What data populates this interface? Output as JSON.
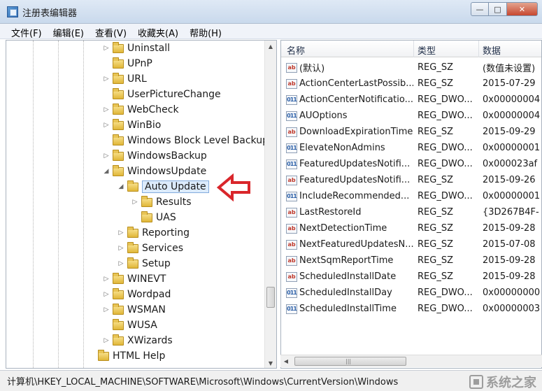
{
  "window": {
    "title": "注册表编辑器",
    "minimize": "—",
    "maximize": "□",
    "close": "✕"
  },
  "menu": [
    "文件(F)",
    "编辑(E)",
    "查看(V)",
    "收藏夹(A)",
    "帮助(H)"
  ],
  "tree": [
    {
      "label": "Uninstall",
      "expander": "▷",
      "level": 0
    },
    {
      "label": "UPnP",
      "expander": "",
      "level": 0
    },
    {
      "label": "URL",
      "expander": "▷",
      "level": 0
    },
    {
      "label": "UserPictureChange",
      "expander": "",
      "level": 0
    },
    {
      "label": "WebCheck",
      "expander": "▷",
      "level": 0
    },
    {
      "label": "WinBio",
      "expander": "▷",
      "level": 0
    },
    {
      "label": "Windows Block Level Backup",
      "expander": "",
      "level": 0
    },
    {
      "label": "WindowsBackup",
      "expander": "▷",
      "level": 0
    },
    {
      "label": "WindowsUpdate",
      "expander": "◢",
      "level": 0
    },
    {
      "label": "Auto Update",
      "expander": "◢",
      "level": 1,
      "selected": true
    },
    {
      "label": "Results",
      "expander": "▷",
      "level": 2
    },
    {
      "label": "UAS",
      "expander": "",
      "level": 2
    },
    {
      "label": "Reporting",
      "expander": "▷",
      "level": 1
    },
    {
      "label": "Services",
      "expander": "▷",
      "level": 1
    },
    {
      "label": "Setup",
      "expander": "▷",
      "level": 1
    },
    {
      "label": "WINEVT",
      "expander": "▷",
      "level": 0
    },
    {
      "label": "Wordpad",
      "expander": "▷",
      "level": 0
    },
    {
      "label": "WSMAN",
      "expander": "▷",
      "level": 0
    },
    {
      "label": "WUSA",
      "expander": "",
      "level": 0
    },
    {
      "label": "XWizards",
      "expander": "▷",
      "level": 0
    },
    {
      "label": "HTML Help",
      "expander": "",
      "level": -1
    }
  ],
  "columns": {
    "name": "名称",
    "type": "类型",
    "data": "数据"
  },
  "values": [
    {
      "icon": "ab",
      "name": "(默认)",
      "type": "REG_SZ",
      "data": "(数值未设置)"
    },
    {
      "icon": "ab",
      "name": "ActionCenterLastPossib...",
      "type": "REG_SZ",
      "data": "2015-07-29"
    },
    {
      "icon": "011",
      "name": "ActionCenterNotificatio...",
      "type": "REG_DWO...",
      "data": "0x00000004"
    },
    {
      "icon": "011",
      "name": "AUOptions",
      "type": "REG_DWO...",
      "data": "0x00000004"
    },
    {
      "icon": "ab",
      "name": "DownloadExpirationTime",
      "type": "REG_SZ",
      "data": "2015-09-29"
    },
    {
      "icon": "011",
      "name": "ElevateNonAdmins",
      "type": "REG_DWO...",
      "data": "0x00000001"
    },
    {
      "icon": "011",
      "name": "FeaturedUpdatesNotifi...",
      "type": "REG_DWO...",
      "data": "0x000023af"
    },
    {
      "icon": "ab",
      "name": "FeaturedUpdatesNotifi...",
      "type": "REG_SZ",
      "data": "2015-09-26"
    },
    {
      "icon": "011",
      "name": "IncludeRecommended...",
      "type": "REG_DWO...",
      "data": "0x00000001"
    },
    {
      "icon": "ab",
      "name": "LastRestoreId",
      "type": "REG_SZ",
      "data": "{3D267B4F-"
    },
    {
      "icon": "ab",
      "name": "NextDetectionTime",
      "type": "REG_SZ",
      "data": "2015-09-28"
    },
    {
      "icon": "ab",
      "name": "NextFeaturedUpdatesN...",
      "type": "REG_SZ",
      "data": "2015-07-08"
    },
    {
      "icon": "ab",
      "name": "NextSqmReportTime",
      "type": "REG_SZ",
      "data": "2015-09-28"
    },
    {
      "icon": "ab",
      "name": "ScheduledInstallDate",
      "type": "REG_SZ",
      "data": "2015-09-28"
    },
    {
      "icon": "011",
      "name": "ScheduledInstallDay",
      "type": "REG_DWO...",
      "data": "0x00000000"
    },
    {
      "icon": "011",
      "name": "ScheduledInstallTime",
      "type": "REG_DWO...",
      "data": "0x00000003"
    }
  ],
  "status": {
    "path": "计算机\\HKEY_LOCAL_MACHINE\\SOFTWARE\\Microsoft\\Windows\\CurrentVersion\\Windows",
    "watermark": "系统之家"
  },
  "colors": {
    "selection": "#dcebfc",
    "annotation_arrow": "#d9262b"
  }
}
